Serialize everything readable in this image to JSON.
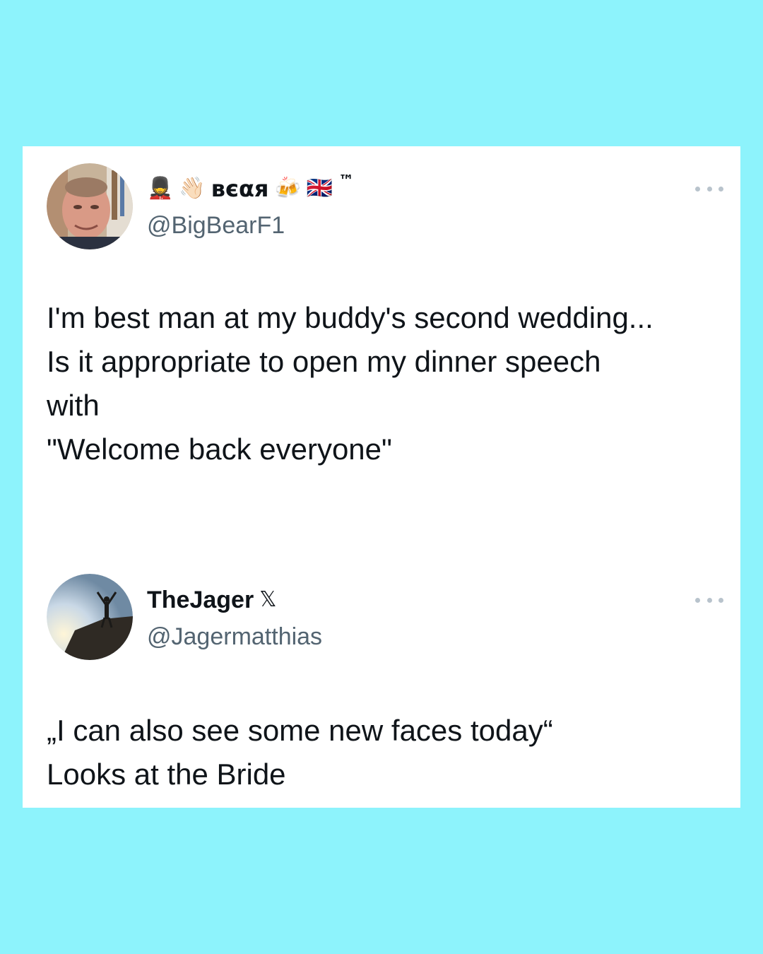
{
  "tweets": [
    {
      "display_name_prefix_emojis": [
        "💂",
        "👋🏻"
      ],
      "display_name": "вєαя",
      "display_name_suffix_emojis": [
        "🍻",
        "🇬🇧"
      ],
      "display_name_trademark": "™",
      "handle": "@BigBearF1",
      "text_lines": [
        "I'm best man at my buddy's second wedding...",
        "Is it appropriate to open my dinner speech",
        "with",
        "\"Welcome back everyone\""
      ]
    },
    {
      "display_name": "TheJager",
      "display_name_badge": "𝕏",
      "handle": "@Jagermatthias",
      "text_lines": [
        "„I can also see some new faces today“",
        "Looks at the Bride"
      ]
    }
  ],
  "colors": {
    "background": "#8df3fc",
    "card": "#ffffff",
    "text_primary": "#0f1419",
    "text_secondary": "#536471"
  },
  "icons": {
    "more_options": "ellipsis-icon"
  }
}
